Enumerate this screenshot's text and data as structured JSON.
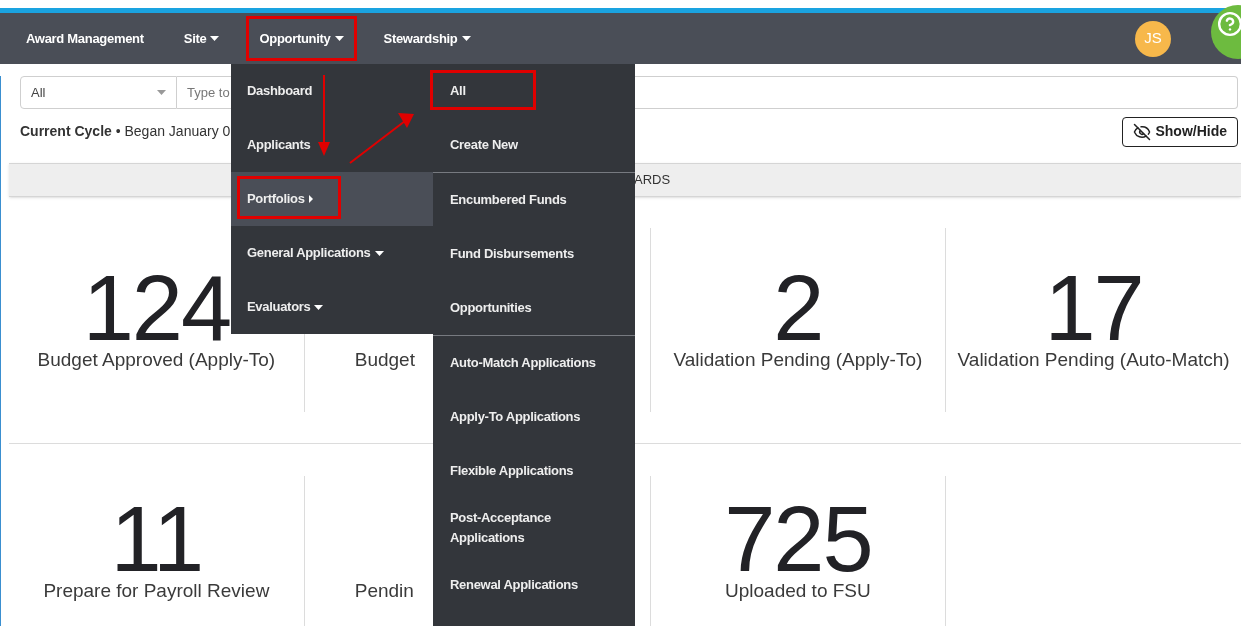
{
  "nav": {
    "items": [
      {
        "label": "Award Management",
        "kind": "link",
        "annotated": false
      },
      {
        "label": "Site",
        "kind": "dropdown",
        "annotated": false
      },
      {
        "label": "Opportunity",
        "kind": "dropdown",
        "annotated": true
      },
      {
        "label": "Stewardship",
        "kind": "dropdown",
        "annotated": false
      }
    ],
    "avatar": "JS"
  },
  "filter": {
    "select": "All",
    "placeholder": "Type to"
  },
  "cycle": "**Current Cycle** • Began January 0",
  "show_hide": "Show/Hide",
  "section_bar": "ARDS",
  "menu": [
    {
      "label": "Dashboard",
      "kind": "link",
      "selected": false,
      "annotated": false
    },
    {
      "label": "Applicants",
      "kind": "link",
      "selected": false,
      "annotated": false
    },
    {
      "label": "Portfolios",
      "kind": "flyout",
      "selected": true,
      "annotated": true
    },
    {
      "label": "General Applications",
      "kind": "dropdown",
      "selected": false,
      "annotated": false
    },
    {
      "label": "Evaluators",
      "kind": "dropdown",
      "selected": false,
      "annotated": false
    }
  ],
  "submenu": [
    [
      {
        "label": "All",
        "annotated": true
      },
      {
        "label": "Create New",
        "annotated": false
      }
    ],
    [
      {
        "label": "Encumbered Funds",
        "annotated": false
      },
      {
        "label": "Fund Disbursements",
        "annotated": false
      },
      {
        "label": "Opportunities",
        "annotated": false
      }
    ],
    [
      {
        "label": "Auto-Match Applications",
        "annotated": false
      },
      {
        "label": "Apply-To Applications",
        "annotated": false
      },
      {
        "label": "Flexible Applications",
        "annotated": false
      },
      {
        "label": "Post-Acceptance Applications",
        "annotated": false
      },
      {
        "label": "Renewal Applications",
        "annotated": false
      }
    ]
  ],
  "stats": [
    [
      {
        "value": "124",
        "label": "Budget Approved (Apply-To)"
      },
      {
        "label": "Budget"
      },
      {
        "value": "2",
        "label": "Validation Pending (Apply-To)"
      },
      {
        "value": "17",
        "label": "Validation Pending (Auto-Match)"
      }
    ],
    [
      {
        "value": "11",
        "label": "Prepare for Payroll Review"
      },
      {
        "label": "Pendin"
      },
      {
        "value": "725",
        "label": "Uploaded to FSU"
      }
    ]
  ]
}
